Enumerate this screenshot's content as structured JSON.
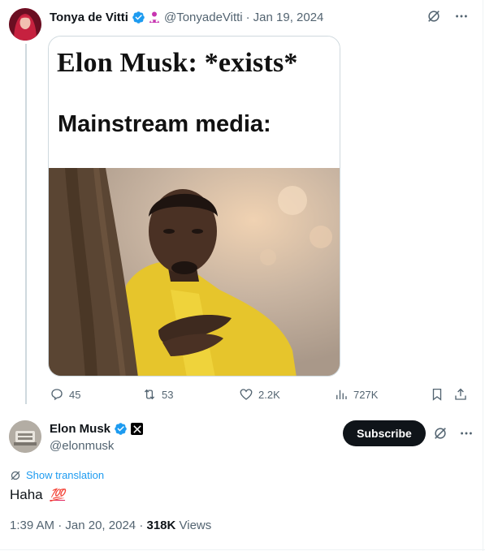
{
  "parent_tweet": {
    "author_name": "Tonya de Vitti",
    "handle": "@TonyadeVitti",
    "separator": "·",
    "date": "Jan 19, 2024",
    "meme": {
      "line1": "Elon Musk: *exists*",
      "line2": "Mainstream media:"
    },
    "stats": {
      "replies": "45",
      "reposts": "53",
      "likes": "2.2K",
      "views": "727K"
    }
  },
  "main_tweet": {
    "author_name": "Elon Musk",
    "handle": "@elonmusk",
    "subscribe_label": "Subscribe",
    "translate_label": "Show translation",
    "text": "Haha",
    "emoji": "💯",
    "time": "1:39 AM",
    "date": "Jan 20, 2024",
    "separator": "·",
    "views_count": "318K",
    "views_label": "Views"
  },
  "colors": {
    "verified_blue": "#1d9bf0",
    "muted_text": "#536471",
    "primary_text": "#0f1419",
    "affiliate_pink": "#c735b0"
  },
  "icons": [
    "grok-icon",
    "more-icon",
    "reply-icon",
    "repost-icon",
    "like-icon",
    "views-icon",
    "bookmark-icon",
    "share-icon",
    "verified-icon",
    "affiliate-icon",
    "x-logo-icon",
    "translate-icon"
  ]
}
